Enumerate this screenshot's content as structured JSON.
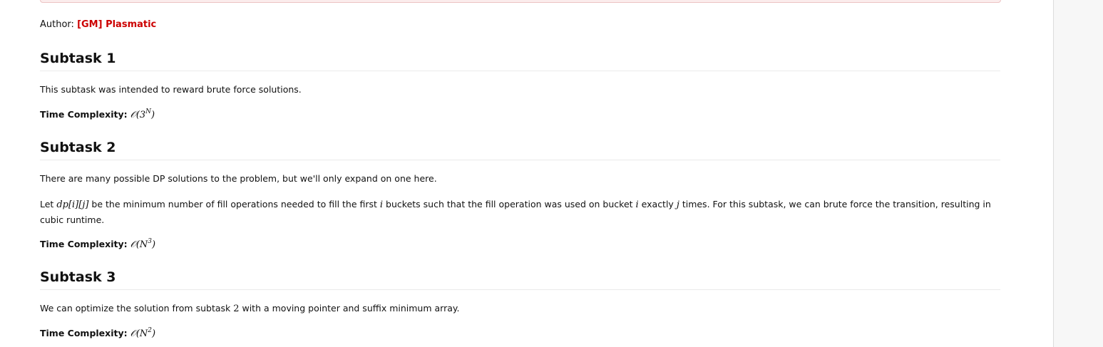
{
  "author": {
    "label": "Author:",
    "name": "[GM] Plasmatic"
  },
  "subtask1": {
    "title": "Subtask 1",
    "text": "This subtask was intended to reward brute force solutions.",
    "complexity_label": "Time Complexity:",
    "complexity_prefix": "𝒪(3",
    "complexity_exp": "N",
    "complexity_suffix": ")"
  },
  "subtask2": {
    "title": "Subtask 2",
    "text1": "There are many possible DP solutions to the problem, but we'll only expand on one here.",
    "text2_a": "Let ",
    "text2_math1": "dp[i][j]",
    "text2_b": " be the minimum number of fill operations needed to fill the first ",
    "text2_math2": "i",
    "text2_c": " buckets such that the fill operation was used on bucket ",
    "text2_math3": "i",
    "text2_d": " exactly ",
    "text2_math4": "j",
    "text2_e": " times. For this subtask, we can brute force the transition, resulting in cubic runtime.",
    "complexity_label": "Time Complexity:",
    "complexity_prefix": "𝒪(N",
    "complexity_exp": "3",
    "complexity_suffix": ")"
  },
  "subtask3": {
    "title": "Subtask 3",
    "text_a": "We can optimize the solution from subtask ",
    "text_math": "2",
    "text_b": " with a moving pointer and suffix minimum array.",
    "complexity_label": "Time Complexity:",
    "complexity_prefix": "𝒪(N",
    "complexity_exp": "2",
    "complexity_suffix": ")"
  }
}
